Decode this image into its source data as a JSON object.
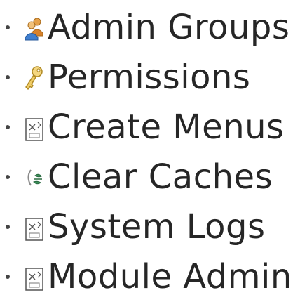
{
  "menu": {
    "items": [
      {
        "label": "Admin Groups",
        "icon": "users-group-icon"
      },
      {
        "label": "Permissions",
        "icon": "key-icon"
      },
      {
        "label": "Create Menus",
        "icon": "broken-image-icon"
      },
      {
        "label": "Clear Caches",
        "icon": "refresh-cache-icon"
      },
      {
        "label": "System Logs",
        "icon": "broken-image-icon"
      },
      {
        "label": "Module Admin",
        "icon": "broken-image-icon"
      }
    ]
  }
}
